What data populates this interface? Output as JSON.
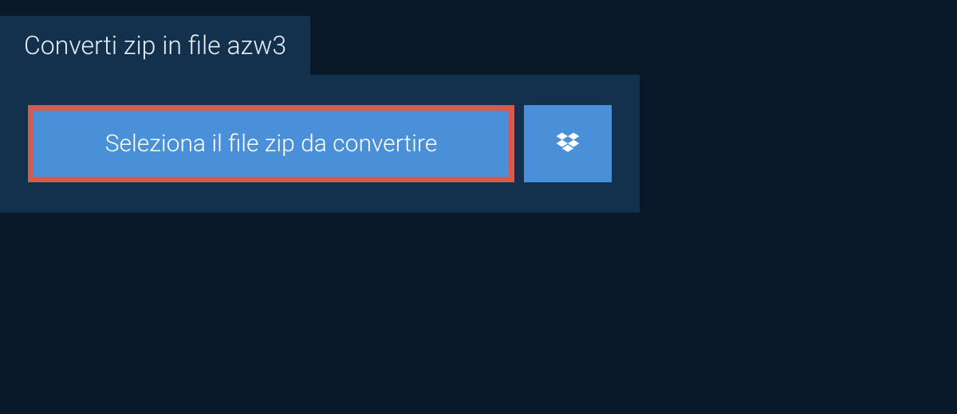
{
  "tab": {
    "title": "Converti zip in file azw3"
  },
  "buttons": {
    "select_label": "Seleziona il file zip da convertire"
  }
}
